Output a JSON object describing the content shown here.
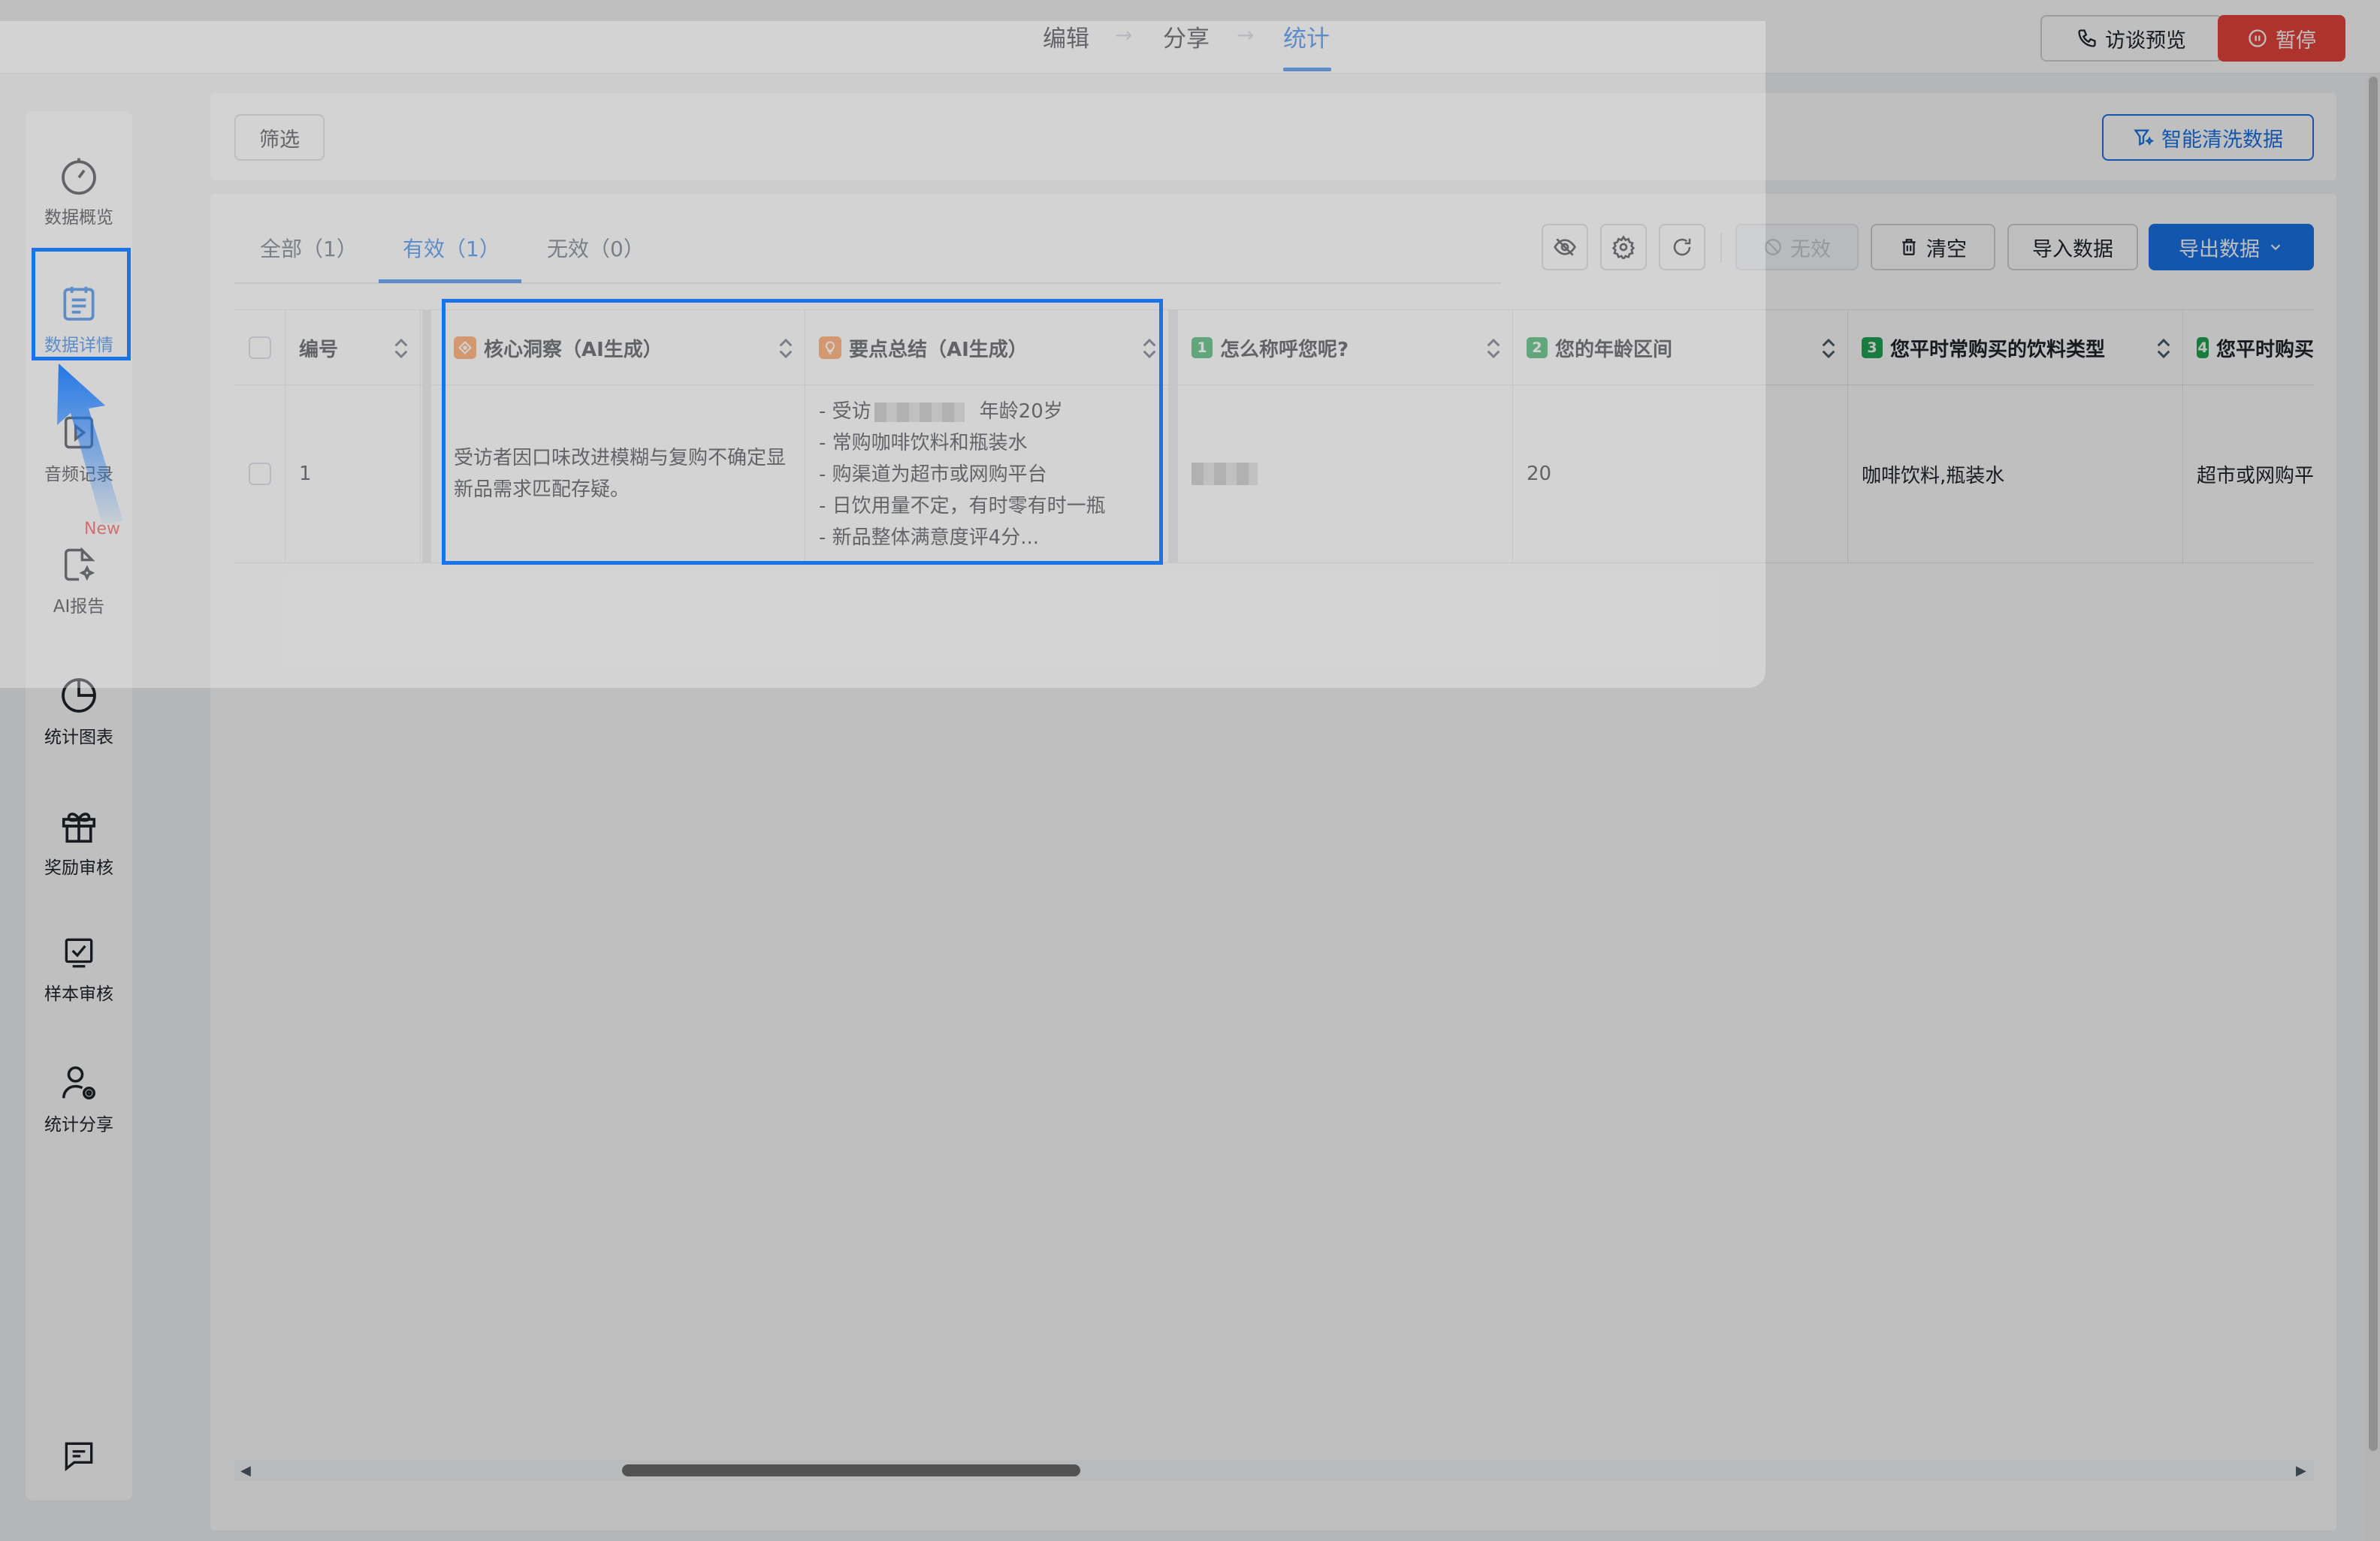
{
  "steps": [
    "编辑",
    "分享",
    "统计"
  ],
  "top_actions": {
    "preview": "访谈预览",
    "pause": "暂停"
  },
  "sidebar": [
    {
      "label": "数据概览",
      "icon": "dashboard-icon"
    },
    {
      "label": "数据详情",
      "icon": "document-list-icon"
    },
    {
      "label": "音频记录",
      "icon": "audio-play-icon"
    },
    {
      "label": "AI报告",
      "icon": "ai-report-icon",
      "badge": "New"
    },
    {
      "label": "统计图表",
      "icon": "pie-chart-icon"
    },
    {
      "label": "奖励审核",
      "icon": "gift-icon"
    },
    {
      "label": "样本审核",
      "icon": "sample-check-icon"
    },
    {
      "label": "统计分享",
      "icon": "user-share-icon"
    }
  ],
  "filter_label": "筛选",
  "smart_clean_label": "智能清洗数据",
  "tabs": [
    "全部（1）",
    "有效（1）",
    "无效（0）"
  ],
  "toolbar": {
    "invalid": "无效",
    "clear": "清空",
    "import": "导入数据",
    "export": "导出数据"
  },
  "table": {
    "headers": {
      "id": "编号",
      "insight": "核心洞察（AI生成）",
      "summary": "要点总结（AI生成）",
      "q1": "怎么称呼您呢?",
      "q2": "您的年龄区间",
      "q3": "您平时常购买的饮料类型",
      "q4": "您平时购买"
    },
    "qnums": [
      "1",
      "2",
      "3",
      "4"
    ],
    "row": {
      "id": "1",
      "insight": "受访者因口味改进模糊与复购不确定显新品需求匹配存疑。",
      "summary_lines": {
        "l1a": "- 受访",
        "l1b": "年龄20岁",
        "l2": "- 常购咖啡饮料和瓶装水",
        "l3": "- 购渠道为超市或网购平台",
        "l4": "- 日饮用量不定，有时零有时一瓶",
        "l5": "- 新品整体满意度评4分..."
      },
      "age": "20",
      "drinks": "咖啡饮料,瓶装水",
      "channel": "超市或网购平"
    }
  },
  "colors": {
    "primary": "#1a73e8",
    "pause": "#e8453c",
    "green": "#21a654",
    "orange": "#ff8a3d"
  }
}
